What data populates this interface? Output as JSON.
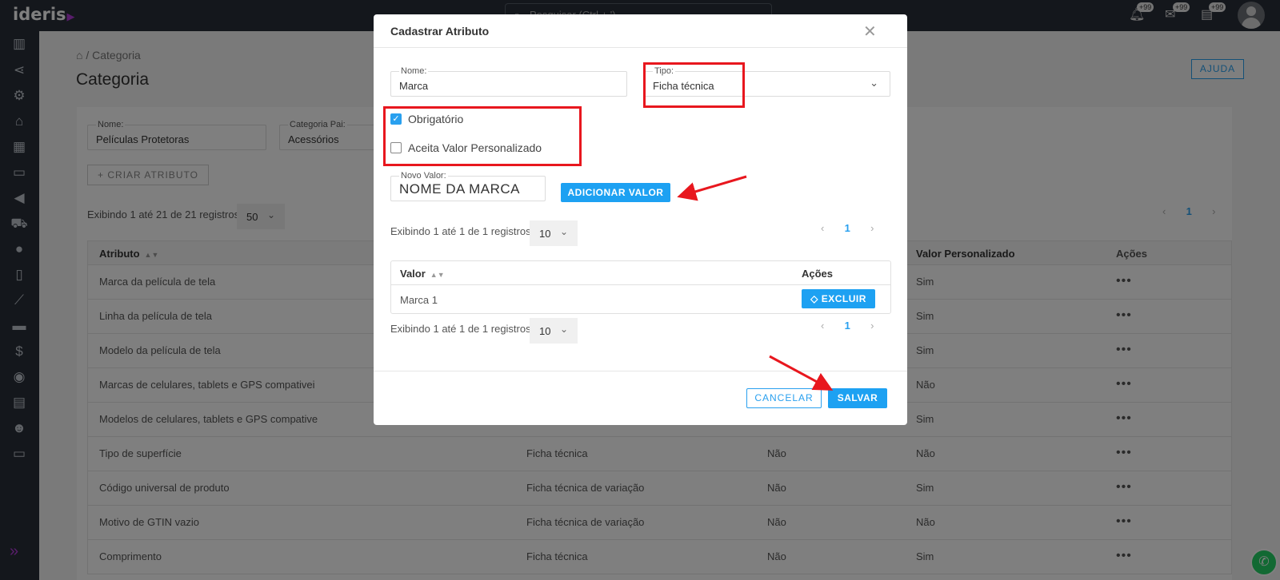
{
  "app": {
    "logo": "ideris",
    "search_placeholder": "Pesquisar (Ctrl + ')",
    "badges": [
      "+99",
      "+99",
      "+99"
    ]
  },
  "sidebar_icons": [
    "chart-icon",
    "share-icon",
    "gear-icon",
    "store-icon",
    "warehouse-icon",
    "archive-icon",
    "megaphone-icon",
    "cart-icon",
    "chat-icon",
    "excel-icon",
    "line-chart-icon",
    "truck-icon",
    "invoice-icon",
    "search-dollar-icon",
    "calculator-icon",
    "users-icon",
    "ticket-icon"
  ],
  "page": {
    "breadcrumb": "Categoria",
    "title": "Categoria",
    "help": "AJUDA"
  },
  "filters": {
    "name_label": "Nome:",
    "name_value": "Películas Protetoras",
    "parent_label": "Categoria Pai:",
    "parent_value": "Acessórios",
    "create_button": "CRIAR ATRIBUTO"
  },
  "list": {
    "info": "Exibindo 1 até 21 de 21 registros",
    "page_size": "50",
    "page": "1"
  },
  "table": {
    "headers": [
      "Atributo",
      "",
      "",
      "Valor Personalizado",
      "Ações"
    ],
    "rows": [
      [
        "Marca da película de tela",
        "",
        "",
        "Sim"
      ],
      [
        "Linha da película de tela",
        "",
        "",
        "Sim"
      ],
      [
        "Modelo da película de tela",
        "",
        "",
        "Sim"
      ],
      [
        "Marcas de celulares, tablets e GPS compativei",
        "",
        "",
        "Não"
      ],
      [
        "Modelos de celulares, tablets e GPS compative",
        "",
        "",
        "Sim"
      ],
      [
        "Tipo de superfície",
        "Ficha técnica",
        "Não",
        "Não"
      ],
      [
        "Código universal de produto",
        "Ficha técnica de variação",
        "Não",
        "Sim"
      ],
      [
        "Motivo de GTIN vazio",
        "Ficha técnica de variação",
        "Não",
        "Não"
      ],
      [
        "Comprimento",
        "Ficha técnica",
        "Não",
        "Sim"
      ]
    ]
  },
  "modal": {
    "title": "Cadastrar Atributo",
    "name_label": "Nome:",
    "name_value": "Marca",
    "type_label": "Tipo:",
    "type_value": "Ficha técnica",
    "required_label": "Obrigatório",
    "required_checked": true,
    "custom_label": "Aceita Valor Personalizado",
    "custom_checked": false,
    "new_value_label": "Novo Valor:",
    "new_value": "NOME DA MARCA",
    "add_button": "ADICIONAR VALOR",
    "info_top": "Exibindo 1 até 1 de 1 registros",
    "page_size_top": "10",
    "page_top": "1",
    "table_headers": [
      "Valor",
      "Ações"
    ],
    "values": [
      {
        "value": "Marca 1",
        "delete": "EXCLUIR"
      }
    ],
    "info_bottom": "Exibindo 1 até 1 de 1 registros",
    "page_size_bottom": "10",
    "page_bottom": "1",
    "cancel": "CANCELAR",
    "save": "SALVAR"
  },
  "colors": {
    "accent": "#1da1f2",
    "highlight": "#e8171e",
    "sidebar": "#282e38",
    "brand": "#b13bd6"
  }
}
